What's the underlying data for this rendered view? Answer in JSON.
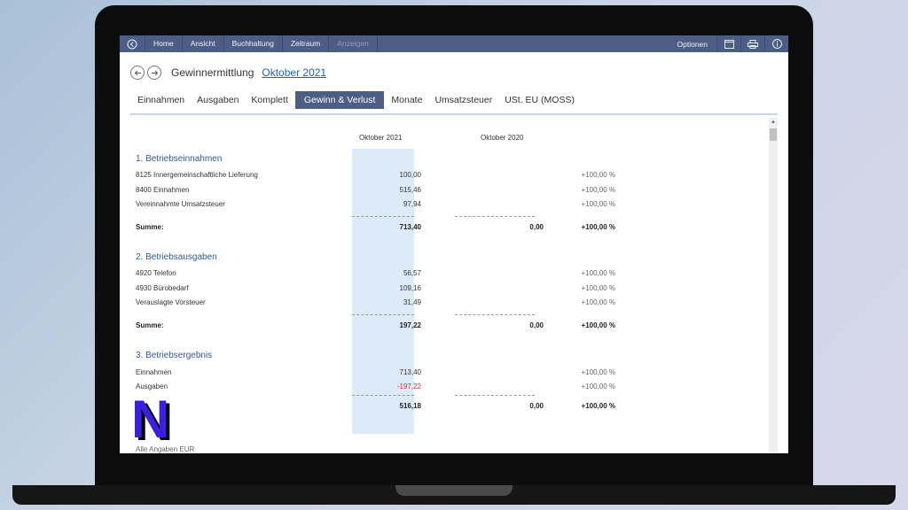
{
  "menu": {
    "items": [
      "Home",
      "Ansicht",
      "Buchhaltung",
      "Zeitraum"
    ],
    "disabled_item": "Anzeigen",
    "options": "Optionen"
  },
  "title": {
    "text": "Gewinnermittlung",
    "link": "Oktober 2021"
  },
  "tabs": [
    "Einnahmen",
    "Ausgaben",
    "Komplett",
    "Gewinn & Verlust",
    "Monate",
    "Umsatzsteuer",
    "USt. EU (MOSS)"
  ],
  "active_tab": "Gewinn & Verlust",
  "columns": {
    "current": "Oktober 2021",
    "previous": "Oktober 2020"
  },
  "sections": [
    {
      "title": "1. Betriebseinnahmen",
      "rows": [
        {
          "label": "8125 Innergemeinschaftliche Lieferung",
          "v1": "100,00",
          "pct": "+100,00 %"
        },
        {
          "label": "8400 Einnahmen",
          "v1": "515,46",
          "pct": "+100,00 %"
        },
        {
          "label": "Vereinnahmte Umsatzsteuer",
          "v1": "97,94",
          "pct": "+100,00 %"
        }
      ],
      "sum": {
        "label": "Summe:",
        "v1": "713,40",
        "v2": "0,00",
        "pct": "+100,00 %"
      }
    },
    {
      "title": "2. Betriebsausgaben",
      "rows": [
        {
          "label": "4920 Telefon",
          "v1": "56,57",
          "pct": "+100,00 %"
        },
        {
          "label": "4930 Bürobedarf",
          "v1": "109,16",
          "pct": "+100,00 %"
        },
        {
          "label": "Verauslagte Vorsteuer",
          "v1": "31,49",
          "pct": "+100,00 %"
        }
      ],
      "sum": {
        "label": "Summe:",
        "v1": "197,22",
        "v2": "0,00",
        "pct": "+100,00 %"
      }
    },
    {
      "title": "3. Betriebsergebnis",
      "rows": [
        {
          "label": "Einnahmen",
          "v1": "713,40",
          "pct": "+100,00 %"
        },
        {
          "label": "Ausgaben",
          "v1": "-197,22",
          "pct": "+100,00 %"
        }
      ],
      "sum": {
        "label": "",
        "v1": "516,18",
        "v2": "0,00",
        "pct": "+100,00 %"
      }
    }
  ],
  "footnote": "Alle Angaben EUR",
  "logo_letter": "N",
  "colors": {
    "menubar": "#4d5e86",
    "highlight": "#ddebf8",
    "link": "#2a5db0",
    "negative": "#c33333",
    "logo": "#3a1fe0"
  }
}
